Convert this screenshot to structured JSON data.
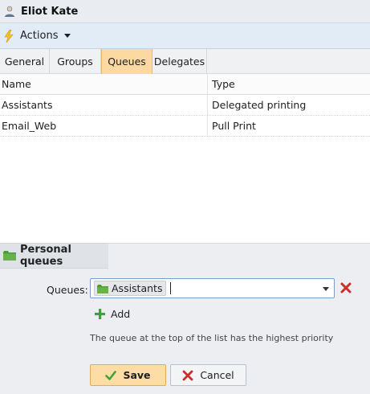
{
  "window": {
    "title": "Eliot Kate"
  },
  "actions": {
    "label": "Actions"
  },
  "tabs": [
    {
      "label": "General",
      "active": false
    },
    {
      "label": "Groups",
      "active": false
    },
    {
      "label": "Queues",
      "active": true
    },
    {
      "label": "Delegates",
      "active": false
    }
  ],
  "table": {
    "columns": [
      "Name",
      "Type"
    ],
    "rows": [
      {
        "name": "Assistants",
        "type": "Delegated printing"
      },
      {
        "name": "Email_Web",
        "type": "Pull Print"
      }
    ]
  },
  "personal_queues": {
    "title": "Personal queues",
    "queues_label": "Queues:",
    "selected_queue": "Assistants",
    "add_label": "Add",
    "hint": "The queue at the top of the list has the highest priority"
  },
  "buttons": {
    "save": "Save",
    "cancel": "Cancel"
  },
  "icons": {
    "user": "user-icon",
    "actions": "lightning-bolt-icon",
    "folder": "green-folder-icon",
    "clear": "red-x-icon",
    "add": "green-plus-icon",
    "save": "green-check-icon",
    "cancel": "red-x-icon"
  },
  "colors": {
    "active_tab": "#fcd9a0",
    "save_button": "#fddca5",
    "actions_bar": "#e1ecf7",
    "input_border": "#7c9dc6"
  }
}
